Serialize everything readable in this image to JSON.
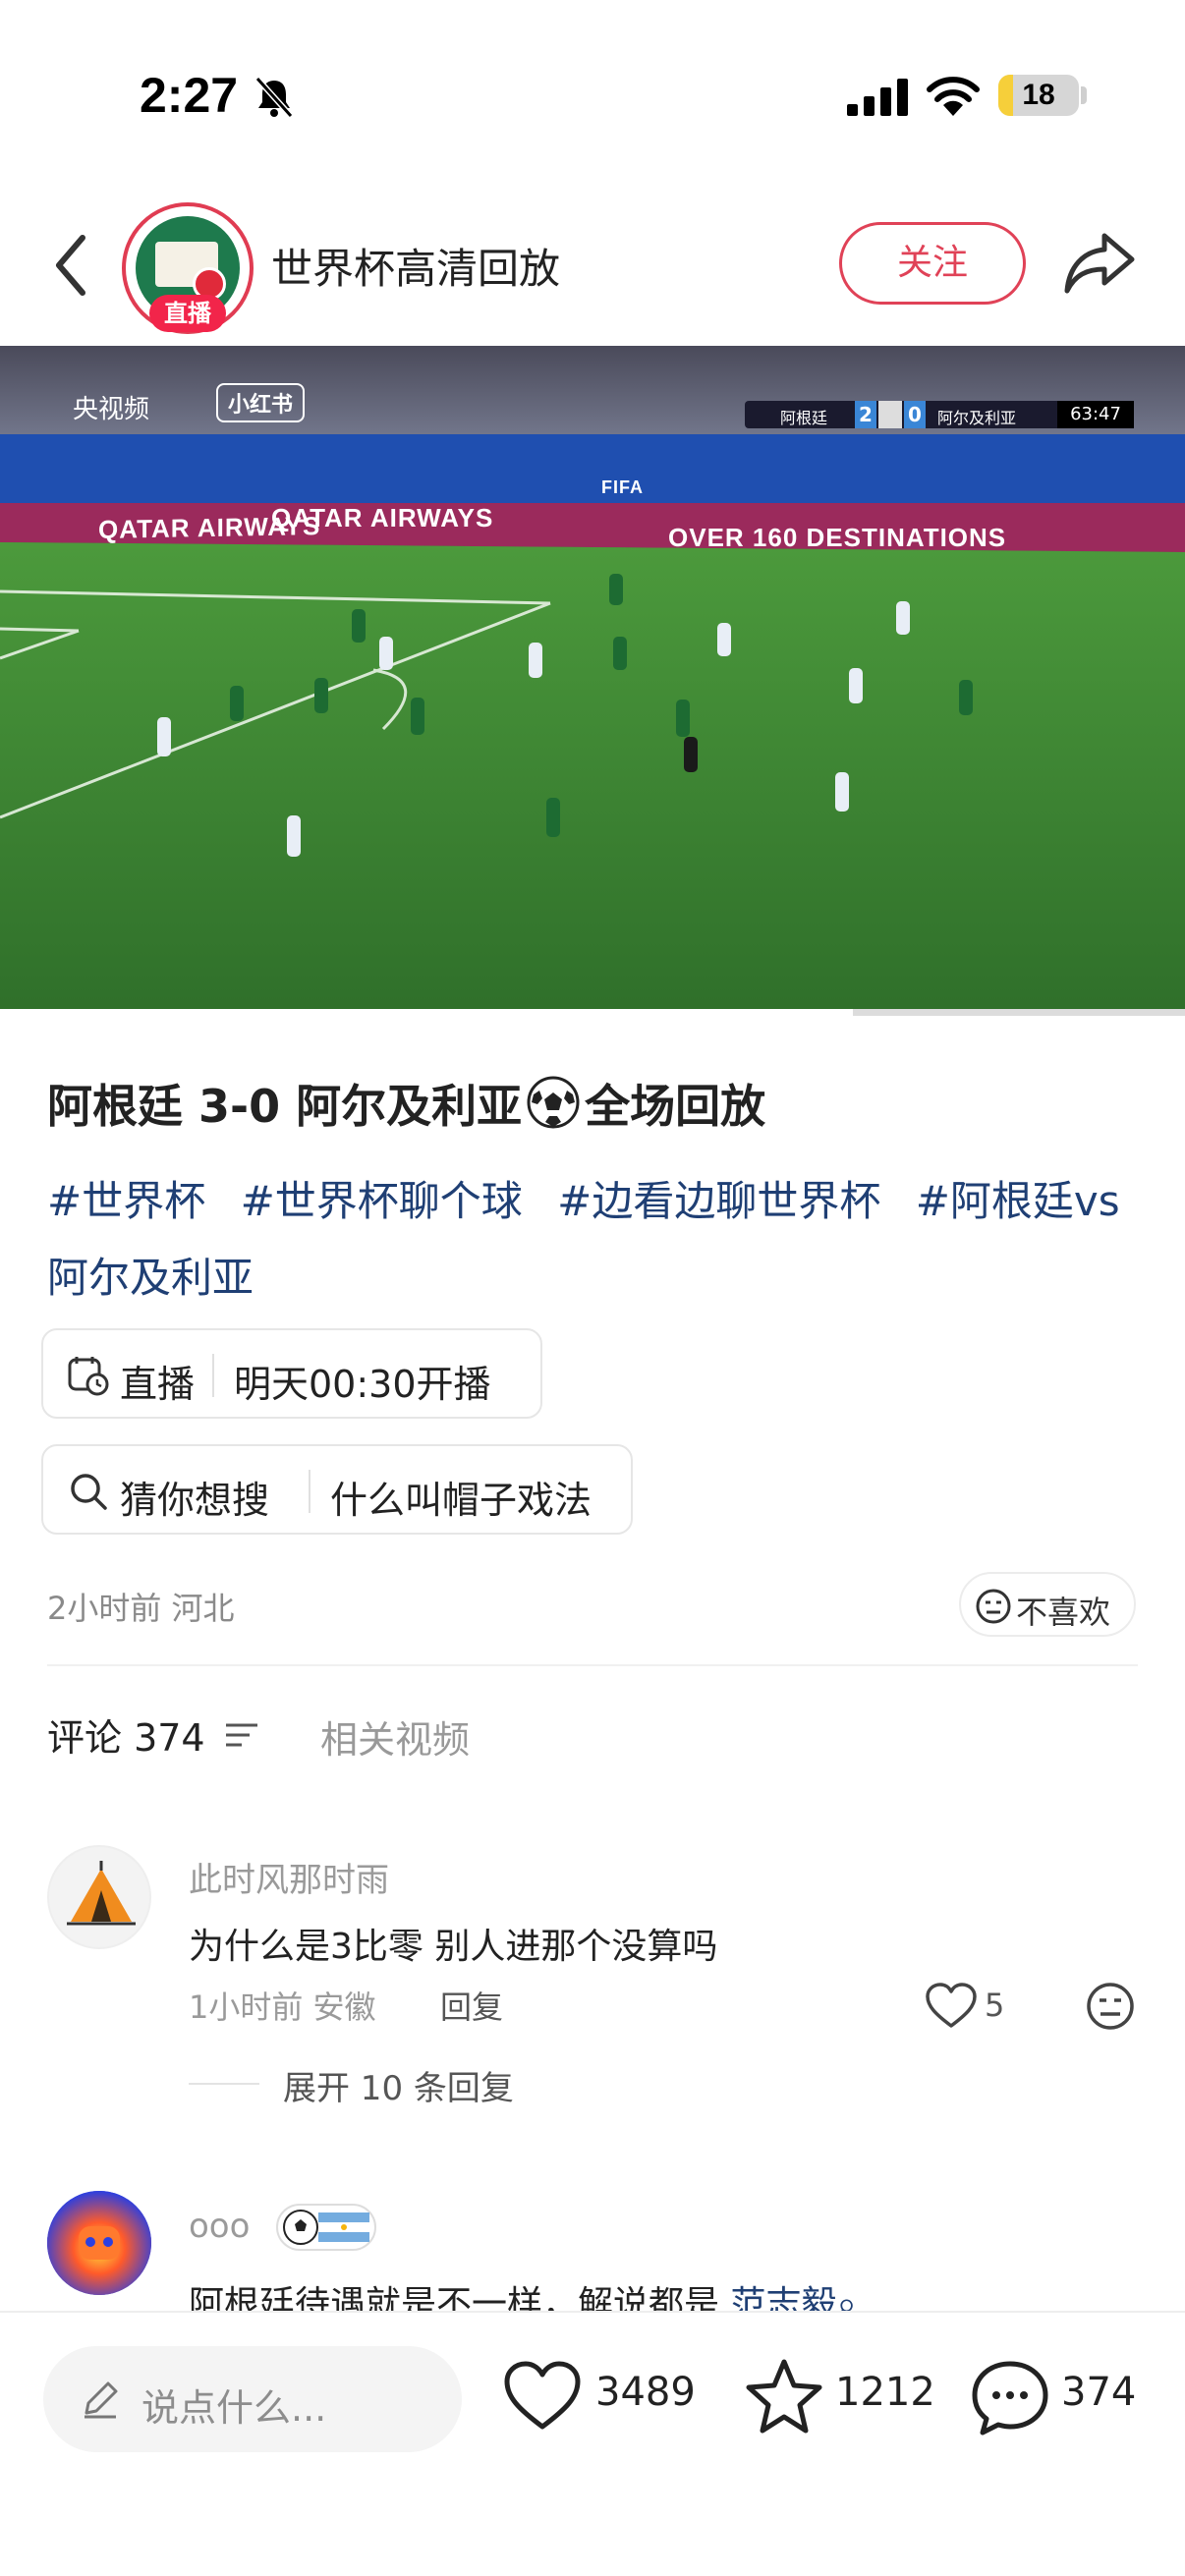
{
  "status_bar": {
    "time": "2:27",
    "battery": "18",
    "battery_level": 0.18
  },
  "header": {
    "channel_name": "世界杯高清回放",
    "live_badge": "直播",
    "follow_label": "关注"
  },
  "video": {
    "watermark_cctv": "央视频",
    "watermark_xhs": "小红书",
    "scoreboard": {
      "team1": "阿根廷",
      "score1": "2",
      "score2": "0",
      "team2": "阿尔及利亚",
      "clock": "63:47"
    },
    "board_text_1": "QATAR AIRWAYS",
    "board_text_2": "QATAR AIRWAYS",
    "board_text_3": "OVER 160 DESTINATIONS",
    "board_text_4": "FIFA",
    "progress": 0.72
  },
  "post": {
    "title_before": "阿根廷 3-0 阿尔及利亚",
    "title_after": "全场回放",
    "tags": [
      "#世界杯",
      "#世界杯聊个球",
      "#边看边聊世界杯",
      "#阿根廷vs阿尔及利亚"
    ],
    "live_label": "直播",
    "live_value": "明天00:30开播",
    "search_label": "猜你想搜",
    "search_value": "什么叫帽子戏法",
    "meta": "2小时前 河北",
    "dislike_label": "不喜欢"
  },
  "comments_section": {
    "comments_tab": "评论 374",
    "related_tab": "相关视频"
  },
  "comments": [
    {
      "user": "此时风那时雨",
      "text": "为什么是3比零  别人进那个没算吗",
      "time_location": "1小时前 安徽",
      "reply_label": "回复",
      "likes": "5",
      "expand_label": "展开 10 条回复"
    },
    {
      "user": "ooo",
      "text": "阿根廷待遇就是不一样，解说都是 ",
      "mention": "范志毅"
    }
  ],
  "bottom_bar": {
    "input_placeholder": "说点什么...",
    "likes": "3489",
    "favorites": "1212",
    "comments": "374"
  }
}
